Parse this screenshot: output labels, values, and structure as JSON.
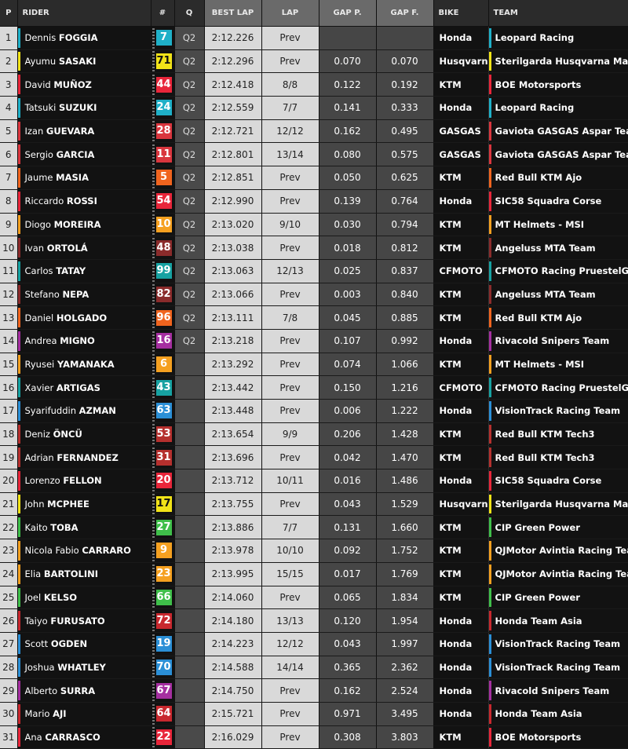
{
  "headers": {
    "p": "P",
    "rider": "RIDER",
    "num": "#",
    "q": "Q",
    "best": "BEST LAP",
    "lap": "LAP",
    "gapp": "GAP P.",
    "gapf": "GAP F.",
    "bike": "BIKE",
    "team": "TEAM"
  },
  "rows": [
    {
      "pos": "1",
      "first": "Dennis",
      "last": "FOGGIA",
      "number": "7",
      "color": "#1fb0c8",
      "q": "Q2",
      "best": "2:12.226",
      "lap": "Prev",
      "gap_p": "",
      "gap_f": "",
      "bike": "Honda",
      "team": "Leopard Racing"
    },
    {
      "pos": "2",
      "first": "Ayumu",
      "last": "SASAKI",
      "number": "71",
      "color": "#f2e318",
      "q": "Q2",
      "best": "2:12.296",
      "lap": "Prev",
      "gap_p": "0.070",
      "gap_f": "0.070",
      "bike": "Husqvarna",
      "team": "Sterilgarda Husqvarna Max"
    },
    {
      "pos": "3",
      "first": "David",
      "last": "MUÑOZ",
      "number": "44",
      "color": "#e8263a",
      "q": "Q2",
      "best": "2:12.418",
      "lap": "8/8",
      "gap_p": "0.122",
      "gap_f": "0.192",
      "bike": "KTM",
      "team": "BOE Motorsports"
    },
    {
      "pos": "4",
      "first": "Tatsuki",
      "last": "SUZUKI",
      "number": "24",
      "color": "#1fb0c8",
      "q": "Q2",
      "best": "2:12.559",
      "lap": "7/7",
      "gap_p": "0.141",
      "gap_f": "0.333",
      "bike": "Honda",
      "team": "Leopard Racing"
    },
    {
      "pos": "5",
      "first": "Izan",
      "last": "GUEVARA",
      "number": "28",
      "color": "#d9363e",
      "q": "Q2",
      "best": "2:12.721",
      "lap": "12/12",
      "gap_p": "0.162",
      "gap_f": "0.495",
      "bike": "GASGAS",
      "team": "Gaviota GASGAS Aspar Team"
    },
    {
      "pos": "6",
      "first": "Sergio",
      "last": "GARCIA",
      "number": "11",
      "color": "#d9363e",
      "q": "Q2",
      "best": "2:12.801",
      "lap": "13/14",
      "gap_p": "0.080",
      "gap_f": "0.575",
      "bike": "GASGAS",
      "team": "Gaviota GASGAS Aspar Team"
    },
    {
      "pos": "7",
      "first": "Jaume",
      "last": "MASIA",
      "number": "5",
      "color": "#f0641e",
      "q": "Q2",
      "best": "2:12.851",
      "lap": "Prev",
      "gap_p": "0.050",
      "gap_f": "0.625",
      "bike": "KTM",
      "team": "Red Bull KTM Ajo"
    },
    {
      "pos": "8",
      "first": "Riccardo",
      "last": "ROSSI",
      "number": "54",
      "color": "#e8263a",
      "q": "Q2",
      "best": "2:12.990",
      "lap": "Prev",
      "gap_p": "0.139",
      "gap_f": "0.764",
      "bike": "Honda",
      "team": "SIC58 Squadra Corse"
    },
    {
      "pos": "9",
      "first": "Diogo",
      "last": "MOREIRA",
      "number": "10",
      "color": "#f5a020",
      "q": "Q2",
      "best": "2:13.020",
      "lap": "9/10",
      "gap_p": "0.030",
      "gap_f": "0.794",
      "bike": "KTM",
      "team": "MT Helmets - MSI"
    },
    {
      "pos": "10",
      "first": "Ivan",
      "last": "ORTOLÁ",
      "number": "48",
      "color": "#8a2b2b",
      "q": "Q2",
      "best": "2:13.038",
      "lap": "Prev",
      "gap_p": "0.018",
      "gap_f": "0.812",
      "bike": "KTM",
      "team": "Angeluss MTA Team"
    },
    {
      "pos": "11",
      "first": "Carlos",
      "last": "TATAY",
      "number": "99",
      "color": "#17a2a2",
      "q": "Q2",
      "best": "2:13.063",
      "lap": "12/13",
      "gap_p": "0.025",
      "gap_f": "0.837",
      "bike": "CFMOTO",
      "team": "CFMOTO Racing PruestelGP"
    },
    {
      "pos": "12",
      "first": "Stefano",
      "last": "NEPA",
      "number": "82",
      "color": "#8a2b2b",
      "q": "Q2",
      "best": "2:13.066",
      "lap": "Prev",
      "gap_p": "0.003",
      "gap_f": "0.840",
      "bike": "KTM",
      "team": "Angeluss MTA Team"
    },
    {
      "pos": "13",
      "first": "Daniel",
      "last": "HOLGADO",
      "number": "96",
      "color": "#f0641e",
      "q": "Q2",
      "best": "2:13.111",
      "lap": "7/8",
      "gap_p": "0.045",
      "gap_f": "0.885",
      "bike": "KTM",
      "team": "Red Bull KTM Ajo"
    },
    {
      "pos": "14",
      "first": "Andrea",
      "last": "MIGNO",
      "number": "16",
      "color": "#a52fa0",
      "q": "Q2",
      "best": "2:13.218",
      "lap": "Prev",
      "gap_p": "0.107",
      "gap_f": "0.992",
      "bike": "Honda",
      "team": "Rivacold Snipers Team"
    },
    {
      "pos": "15",
      "first": "Ryusei",
      "last": "YAMANAKA",
      "number": "6",
      "color": "#f5a020",
      "q": "",
      "best": "2:13.292",
      "lap": "Prev",
      "gap_p": "0.074",
      "gap_f": "1.066",
      "bike": "KTM",
      "team": "MT Helmets - MSI"
    },
    {
      "pos": "16",
      "first": "Xavier",
      "last": "ARTIGAS",
      "number": "43",
      "color": "#17a2a2",
      "q": "",
      "best": "2:13.442",
      "lap": "Prev",
      "gap_p": "0.150",
      "gap_f": "1.216",
      "bike": "CFMOTO",
      "team": "CFMOTO Racing PruestelGP"
    },
    {
      "pos": "17",
      "first": "Syarifuddin",
      "last": "AZMAN",
      "number": "63",
      "color": "#2b8fd6",
      "q": "",
      "best": "2:13.448",
      "lap": "Prev",
      "gap_p": "0.006",
      "gap_f": "1.222",
      "bike": "Honda",
      "team": "VisionTrack Racing Team"
    },
    {
      "pos": "18",
      "first": "Deniz",
      "last": "ÖNCÜ",
      "number": "53",
      "color": "#b5302e",
      "q": "",
      "best": "2:13.654",
      "lap": "9/9",
      "gap_p": "0.206",
      "gap_f": "1.428",
      "bike": "KTM",
      "team": "Red Bull KTM Tech3"
    },
    {
      "pos": "19",
      "first": "Adrian",
      "last": "FERNANDEZ",
      "number": "31",
      "color": "#b5302e",
      "q": "",
      "best": "2:13.696",
      "lap": "Prev",
      "gap_p": "0.042",
      "gap_f": "1.470",
      "bike": "KTM",
      "team": "Red Bull KTM Tech3"
    },
    {
      "pos": "20",
      "first": "Lorenzo",
      "last": "FELLON",
      "number": "20",
      "color": "#e8263a",
      "q": "",
      "best": "2:13.712",
      "lap": "10/11",
      "gap_p": "0.016",
      "gap_f": "1.486",
      "bike": "Honda",
      "team": "SIC58 Squadra Corse"
    },
    {
      "pos": "21",
      "first": "John",
      "last": "MCPHEE",
      "number": "17",
      "color": "#f2e318",
      "q": "",
      "best": "2:13.755",
      "lap": "Prev",
      "gap_p": "0.043",
      "gap_f": "1.529",
      "bike": "Husqvarna",
      "team": "Sterilgarda Husqvarna Max"
    },
    {
      "pos": "22",
      "first": "Kaito",
      "last": "TOBA",
      "number": "27",
      "color": "#3fbf4a",
      "q": "",
      "best": "2:13.886",
      "lap": "7/7",
      "gap_p": "0.131",
      "gap_f": "1.660",
      "bike": "KTM",
      "team": "CIP Green Power"
    },
    {
      "pos": "23",
      "first": "Nicola Fabio",
      "last": "CARRARO",
      "number": "9",
      "color": "#f5a020",
      "q": "",
      "best": "2:13.978",
      "lap": "10/10",
      "gap_p": "0.092",
      "gap_f": "1.752",
      "bike": "KTM",
      "team": "QJMotor Avintia Racing Team"
    },
    {
      "pos": "24",
      "first": "Elia",
      "last": "BARTOLINI",
      "number": "23",
      "color": "#f5a020",
      "q": "",
      "best": "2:13.995",
      "lap": "15/15",
      "gap_p": "0.017",
      "gap_f": "1.769",
      "bike": "KTM",
      "team": "QJMotor Avintia Racing Team"
    },
    {
      "pos": "25",
      "first": "Joel",
      "last": "KELSO",
      "number": "66",
      "color": "#3fbf4a",
      "q": "",
      "best": "2:14.060",
      "lap": "Prev",
      "gap_p": "0.065",
      "gap_f": "1.834",
      "bike": "KTM",
      "team": "CIP Green Power"
    },
    {
      "pos": "26",
      "first": "Taiyo",
      "last": "FURUSATO",
      "number": "72",
      "color": "#c8282e",
      "q": "",
      "best": "2:14.180",
      "lap": "13/13",
      "gap_p": "0.120",
      "gap_f": "1.954",
      "bike": "Honda",
      "team": "Honda Team Asia"
    },
    {
      "pos": "27",
      "first": "Scott",
      "last": "OGDEN",
      "number": "19",
      "color": "#2b8fd6",
      "q": "",
      "best": "2:14.223",
      "lap": "12/12",
      "gap_p": "0.043",
      "gap_f": "1.997",
      "bike": "Honda",
      "team": "VisionTrack Racing Team"
    },
    {
      "pos": "28",
      "first": "Joshua",
      "last": "WHATLEY",
      "number": "70",
      "color": "#2b8fd6",
      "q": "",
      "best": "2:14.588",
      "lap": "14/14",
      "gap_p": "0.365",
      "gap_f": "2.362",
      "bike": "Honda",
      "team": "VisionTrack Racing Team"
    },
    {
      "pos": "29",
      "first": "Alberto",
      "last": "SURRA",
      "number": "67",
      "color": "#a52fa0",
      "q": "",
      "best": "2:14.750",
      "lap": "Prev",
      "gap_p": "0.162",
      "gap_f": "2.524",
      "bike": "Honda",
      "team": "Rivacold Snipers Team"
    },
    {
      "pos": "30",
      "first": "Mario",
      "last": "AJI",
      "number": "64",
      "color": "#c8282e",
      "q": "",
      "best": "2:15.721",
      "lap": "Prev",
      "gap_p": "0.971",
      "gap_f": "3.495",
      "bike": "Honda",
      "team": "Honda Team Asia"
    },
    {
      "pos": "31",
      "first": "Ana",
      "last": "CARRASCO",
      "number": "22",
      "color": "#e8263a",
      "q": "",
      "best": "2:16.029",
      "lap": "Prev",
      "gap_p": "0.308",
      "gap_f": "3.803",
      "bike": "KTM",
      "team": "BOE Motorsports"
    }
  ]
}
